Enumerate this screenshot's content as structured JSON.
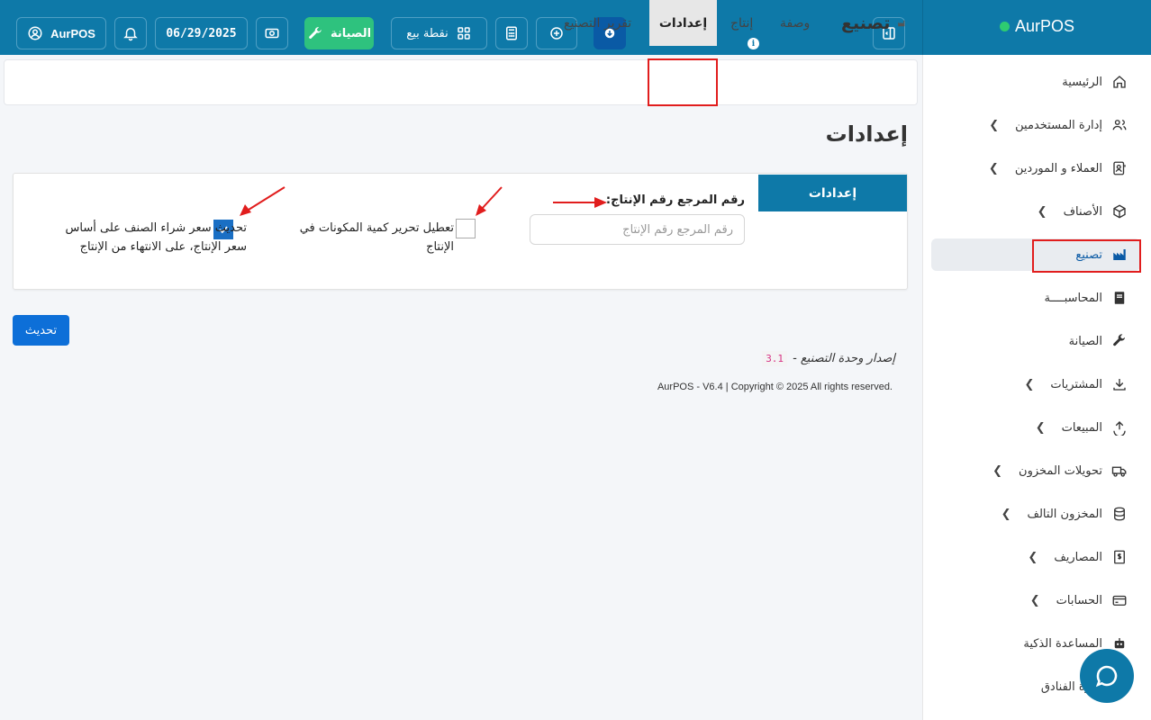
{
  "header": {
    "user_label": "AurPOS",
    "date": "06/29/2025",
    "maintenance_label": "الصيانة",
    "pos_label": "نقطة بيع"
  },
  "brand": {
    "name": "AurPOS"
  },
  "sidebar": {
    "items": [
      {
        "label": "الرئيسية",
        "icon": "home-icon",
        "chevron": false
      },
      {
        "label": "إدارة المستخدمين",
        "icon": "users-icon",
        "chevron": true
      },
      {
        "label": "العملاء و الموردين",
        "icon": "contacts-icon",
        "chevron": true
      },
      {
        "label": "الأصناف",
        "icon": "box-icon",
        "chevron": true
      },
      {
        "label": "تصنيع",
        "icon": "factory-icon",
        "chevron": false,
        "active": true
      },
      {
        "label": "المحاسبــــة",
        "icon": "book-icon",
        "chevron": false
      },
      {
        "label": "الصيانة",
        "icon": "wrench-icon",
        "chevron": false
      },
      {
        "label": "المشتريات",
        "icon": "download-icon",
        "chevron": true
      },
      {
        "label": "المبيعات",
        "icon": "upload-icon",
        "chevron": true
      },
      {
        "label": "تحويلات المخزون",
        "icon": "truck-icon",
        "chevron": true
      },
      {
        "label": "المخزون التالف",
        "icon": "database-icon",
        "chevron": true
      },
      {
        "label": "المصاريف",
        "icon": "receipt-icon",
        "chevron": true
      },
      {
        "label": "الحسابات",
        "icon": "card-icon",
        "chevron": true
      },
      {
        "label": "المساعدة الذكية",
        "icon": "robot-icon",
        "chevron": false
      },
      {
        "label": "إدارة الفنادق",
        "icon": "hotel-icon",
        "chevron": false
      }
    ]
  },
  "tabs": {
    "module": "تصنيع",
    "items": [
      "وصفة",
      "إنتاج",
      "إعدادات",
      "تقرير التصنيع"
    ],
    "active": "إعدادات"
  },
  "page": {
    "title": "إعدادات",
    "card_tab": "إعدادات",
    "ref_label": "رقم المرجع رقم الإنتاج:",
    "ref_placeholder": "رقم المرجع رقم الإنتاج",
    "disable_edit_label": "تعطيل تحرير كمية المكونات في الإنتاج",
    "disable_edit_checked": false,
    "update_price_label": "تحديث سعر شراء الصنف على أساس سعر الإنتاج، على الانتهاء من الإنتاج",
    "update_price_checked": true,
    "update_button": "تحديث",
    "version_label": "إصدار وحدة التصنيع -",
    "version_number": "3.1",
    "copyright": "AurPOS - V6.4 | Copyright © 2025 All rights reserved."
  },
  "colors": {
    "header": "#0e79a8",
    "accent_green": "#2ec27e",
    "primary_button": "#0d6fd8",
    "annotation_red": "#e11d1d"
  }
}
